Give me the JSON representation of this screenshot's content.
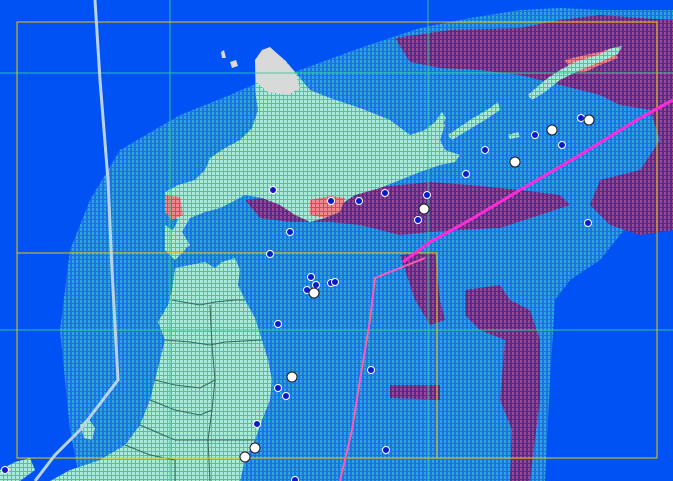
{
  "map": {
    "colors": {
      "ocean": "#0052f5",
      "shallow_grid": "#29a8d6",
      "land": "#a8ecd6",
      "land_grid": "#3fc7b5",
      "high_zone": "#7a3c8c",
      "alert_zone": "#e65a5a",
      "grey_land": "#d9d9d9",
      "frame": "#f2c200",
      "grid_line": "#2ccf92",
      "magenta_line": "#ff2bd8",
      "pink_line": "#ff5ab4",
      "white_line": "#b8d2ea",
      "border_line": "#2a6f55"
    },
    "legend": [],
    "markers": {
      "blue_count": 28,
      "white_count": 8
    }
  }
}
